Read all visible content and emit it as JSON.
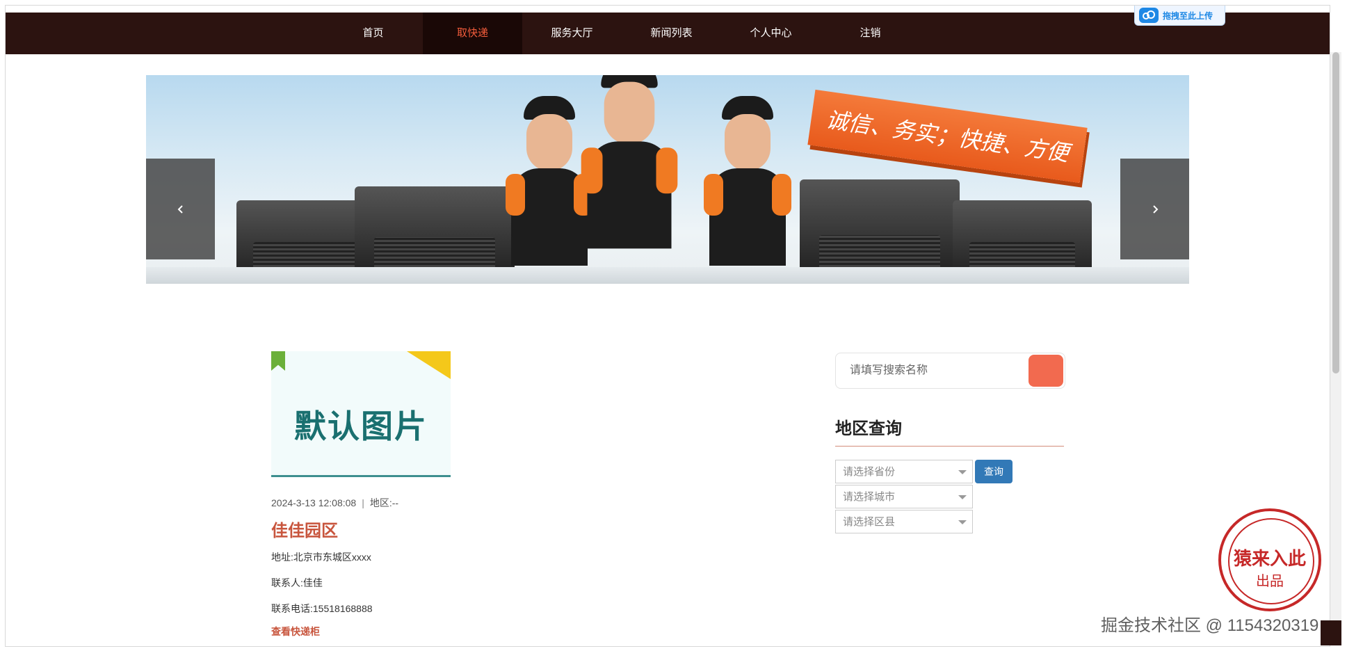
{
  "nav": {
    "items": [
      {
        "label": "首页"
      },
      {
        "label": "取快递"
      },
      {
        "label": "服务大厅"
      },
      {
        "label": "新闻列表"
      },
      {
        "label": "个人中心"
      },
      {
        "label": "注销"
      }
    ],
    "active_index": 1,
    "upload_label": "拖拽至此上传"
  },
  "banner": {
    "slogan": "诚信、务实；快捷、方便",
    "prev_icon": "chevron-left-icon",
    "next_icon": "chevron-right-icon"
  },
  "item": {
    "image_text": "默认图片",
    "date": "2024-3-13 12:08:08",
    "region": "地区:--",
    "title": "佳佳园区",
    "address": "地址:北京市东城区xxxx",
    "contact": "联系人:佳佳",
    "phone": "联系电话:15518168888",
    "link": "查看快递柜"
  },
  "sidebar": {
    "search_placeholder": "请填写搜索名称",
    "section_title": "地区查询",
    "province_placeholder": "请选择省份",
    "city_placeholder": "请选择城市",
    "district_placeholder": "请选择区县",
    "query_label": "查询"
  },
  "overlay": {
    "stamp_line1": "猿来入此",
    "stamp_line2": "出品",
    "watermark": "掘金技术社区 @ 1154320319"
  },
  "colors": {
    "nav_bg": "#2c1310",
    "accent": "#f25c3b",
    "title_red": "#c8553d",
    "query_blue": "#3279b7"
  }
}
